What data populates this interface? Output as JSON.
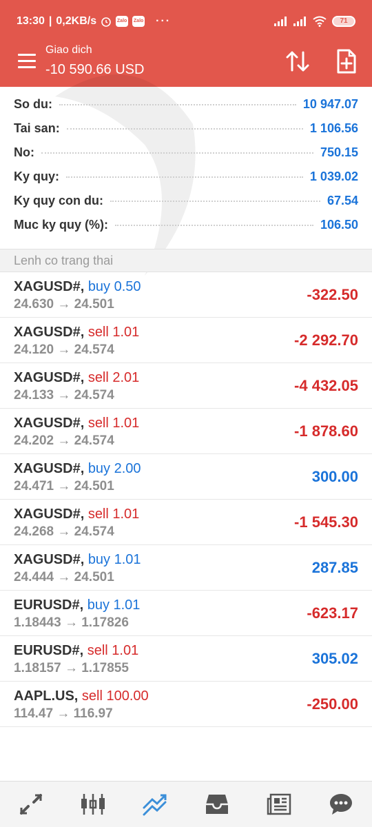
{
  "status_bar": {
    "time": "13:30",
    "net_speed": "0,2KB/s",
    "zalo_label": "Zalo",
    "dots": "···",
    "battery": "71"
  },
  "header": {
    "title": "Giao dich",
    "balance": "-10 590.66 USD"
  },
  "summary": [
    {
      "label": "So du:",
      "value": "10 947.07"
    },
    {
      "label": "Tai san:",
      "value": "1 106.56"
    },
    {
      "label": "No:",
      "value": "750.15"
    },
    {
      "label": "Ky quy:",
      "value": "1 039.02"
    },
    {
      "label": "Ky quy con du:",
      "value": "67.54"
    },
    {
      "label": "Muc ky quy (%):",
      "value": "106.50"
    }
  ],
  "section_title": "Lenh co trang thai",
  "orders": [
    {
      "symbol": "XAGUSD#,",
      "type": "buy 0.50",
      "prices": "24.630 → 24.501",
      "profit": "-322.50"
    },
    {
      "symbol": "XAGUSD#,",
      "type": "sell 1.01",
      "prices": "24.120 → 24.574",
      "profit": "-2 292.70"
    },
    {
      "symbol": "XAGUSD#,",
      "type": "sell 2.01",
      "prices": "24.133 → 24.574",
      "profit": "-4 432.05"
    },
    {
      "symbol": "XAGUSD#,",
      "type": "sell 1.01",
      "prices": "24.202 → 24.574",
      "profit": "-1 878.60"
    },
    {
      "symbol": "XAGUSD#,",
      "type": "buy 2.00",
      "prices": "24.471 → 24.501",
      "profit": "300.00"
    },
    {
      "symbol": "XAGUSD#,",
      "type": "sell 1.01",
      "prices": "24.268 → 24.574",
      "profit": "-1 545.30"
    },
    {
      "symbol": "XAGUSD#,",
      "type": "buy 1.01",
      "prices": "24.444 → 24.501",
      "profit": "287.85"
    },
    {
      "symbol": "EURUSD#,",
      "type": "buy 1.01",
      "prices": "1.18443 → 1.17826",
      "profit": "-623.17"
    },
    {
      "symbol": "EURUSD#,",
      "type": "sell 1.01",
      "prices": "1.18157 → 1.17855",
      "profit": "305.02"
    },
    {
      "symbol": "AAPL.US,",
      "type": "sell 100.00",
      "prices": "114.47 → 116.97",
      "profit": "-250.00"
    }
  ],
  "colors": {
    "header_bg": "#e2574c",
    "buy": "#1a73d9",
    "sell": "#d62b2b",
    "nav_active": "#3b8fd9"
  },
  "icons": {
    "menu": "hamburger-icon",
    "sort": "sort-arrows-icon",
    "new_order": "new-document-icon",
    "nav": [
      "quotes-icon",
      "chart-icon",
      "trade-icon",
      "history-icon",
      "news-icon",
      "messages-icon"
    ]
  }
}
